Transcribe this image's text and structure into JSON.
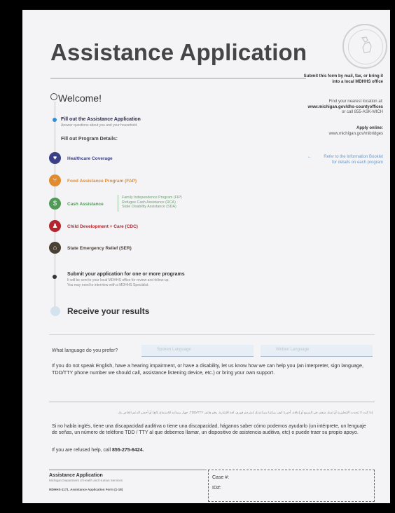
{
  "title": "Assistance Application",
  "right_info": {
    "submit": "Submit this form by mail, fax, or bring it into a local MDHHS office",
    "find_line1": "Find your nearest location at:",
    "find_url": "www.michigan.gov/dhs-countyoffices",
    "find_call": "or call 855-ASK-MICH",
    "apply_label": "Apply online:",
    "apply_url": "www.michigan.gov/mibridges",
    "refer": "Refer to the Information Booklet for details on each program"
  },
  "welcome": "Welcome!",
  "step1": {
    "title": "Fill out the Assistance Application",
    "sub": "Answer questions about you and your household."
  },
  "program_details": "Fill out Program Details:",
  "programs": [
    {
      "label": "Healthcare Coverage",
      "color": "#3b3f86",
      "icon": "heart-icon",
      "glyph": "♥"
    },
    {
      "label": "Food Assistance Program (FAP)",
      "color": "#e08b2e",
      "icon": "utensils-icon",
      "glyph": "⑂"
    },
    {
      "label": "Cash Assistance",
      "color": "#4f9a57",
      "icon": "dollar-icon",
      "glyph": "$",
      "sub": [
        "Family Independence Program (FIP)",
        "Refugee Cash Assistance (RCA)",
        "State Disability Assistance (SDA)"
      ]
    },
    {
      "label": "Child Development + Care (CDC)",
      "color": "#b3262e",
      "icon": "children-icon",
      "glyph": "♟"
    },
    {
      "label": "State Emergency Relief (SER)",
      "color": "#4a3f35",
      "icon": "house-icon",
      "glyph": "⌂"
    }
  ],
  "submit_step": {
    "title": "Submit your application for one or more programs",
    "sub1": "It will be sent to your local MDHHS office for review and follow-up.",
    "sub2": "You may need to interview with a MDHHS Specialist."
  },
  "receive": "Receive your results",
  "language": {
    "question": "What language do you prefer?",
    "spoken_placeholder": "Spoken Language",
    "written_placeholder": "Written Language"
  },
  "english_para": "If you do not speak English, have a hearing impairment, or have a disability, let us know how we can help you (an interpreter, sign language, TDD/TTY phone number we should call, assistance listening device, etc.) or bring your own support.",
  "arabic_para": "إذا كنت لا تتحدث الإنجليزية أو لديك ضعف في السمع أو إعاقة، أخبرنا كيف يمكننا مساعدتك (مترجم فوري، لغة الإشارة، رقم هاتف TDD/TTY، جهاز مساعد للاستماع، إلخ) أو أحضر الدعم الخاص بك.",
  "spanish_para": "Si no habla inglés, tiene una discapacidad auditiva o tiene una discapacidad, háganos saber cómo podemos ayudarlo (un intérprete, un lenguaje de señas, un número de teléfono TDD / TTY al que debemos llamar, un dispositivo de asistencia auditiva, etc) o puede traer su propio apoyo.",
  "refused_prefix": "If you are refused help, call ",
  "refused_phone": "855-275-6424.",
  "footer": {
    "title": "Assistance Application",
    "dept": "Michigan Department of Health and Human Services",
    "form": "MDHHS-1171, Assistance Application Form (1-18)",
    "case_label": "Case #:",
    "id_label": "ID#:"
  }
}
